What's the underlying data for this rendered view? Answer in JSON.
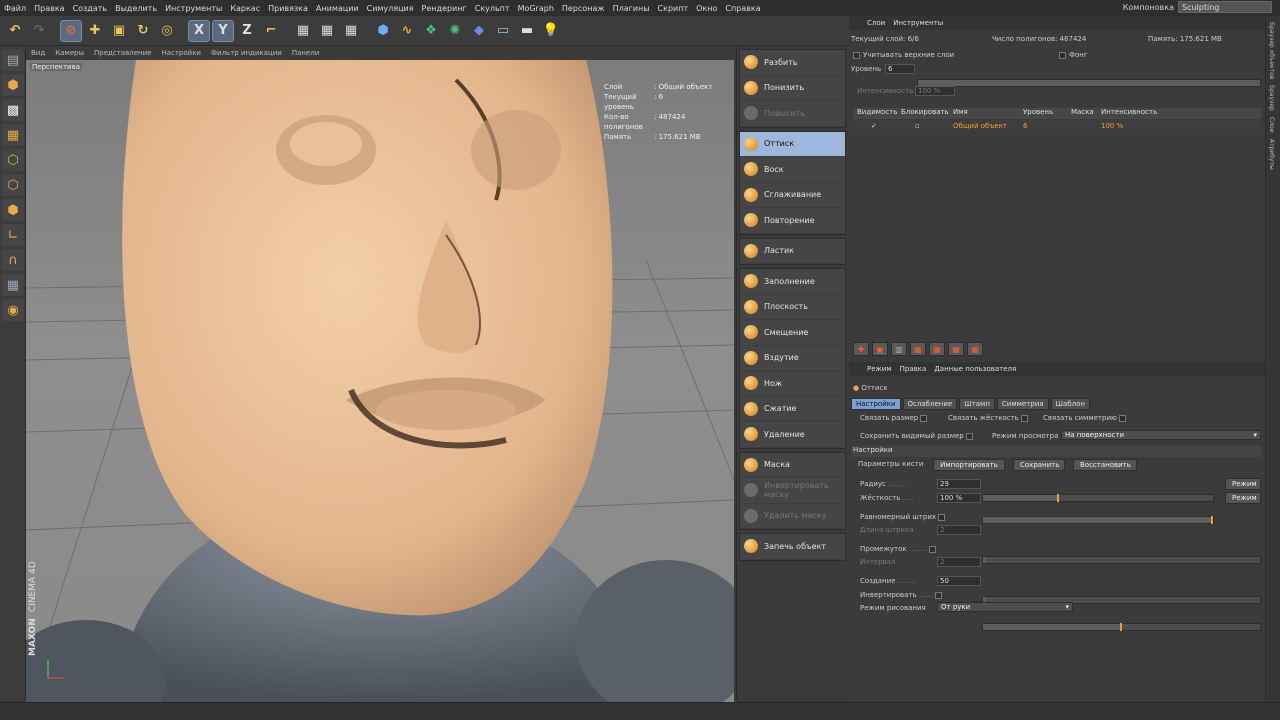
{
  "menu": [
    "Файл",
    "Правка",
    "Создать",
    "Выделить",
    "Инструменты",
    "Каркас",
    "Привязка",
    "Анимации",
    "Симуляция",
    "Рендеринг",
    "Скульпт",
    "MoGraph",
    "Персонаж",
    "Плагины",
    "Скрипт",
    "Окно",
    "Справка"
  ],
  "layout": {
    "label": "Компоновка",
    "value": "Sculpting"
  },
  "toolbar": {
    "x": "X",
    "y": "Y",
    "z": "Z"
  },
  "viewport_menu": [
    "Вид",
    "Камеры",
    "Представление",
    "Настройки",
    "Фильтр индикации",
    "Панели"
  ],
  "viewport": {
    "label": "Перспектива",
    "info": [
      [
        "Слой",
        ": Общий объект"
      ],
      [
        "Текущий уровень",
        ": 6"
      ],
      [
        "Кол-во полигонов",
        ": 487424"
      ],
      [
        "Память",
        ": 175.621 MB"
      ]
    ],
    "logo_line1": "MAXON",
    "logo_line2": "CINEMA 4D"
  },
  "brushes": {
    "g1": [
      {
        "label": "Разбить",
        "state": "normal"
      },
      {
        "label": "Понизить",
        "state": "normal"
      },
      {
        "label": "Повысить",
        "state": "disabled"
      }
    ],
    "g2": [
      {
        "label": "Оттиск",
        "state": "active"
      },
      {
        "label": "Воск",
        "state": "normal"
      },
      {
        "label": "Сглаживание",
        "state": "normal"
      },
      {
        "label": "Повторение",
        "state": "normal"
      }
    ],
    "g3": [
      {
        "label": "Ластик",
        "state": "normal"
      }
    ],
    "g4": [
      {
        "label": "Заполнение",
        "state": "normal"
      },
      {
        "label": "Плоскость",
        "state": "normal"
      },
      {
        "label": "Смещение",
        "state": "normal"
      },
      {
        "label": "Вздутие",
        "state": "normal"
      },
      {
        "label": "Нож",
        "state": "normal"
      },
      {
        "label": "Сжатие",
        "state": "normal"
      },
      {
        "label": "Удаление",
        "state": "normal"
      }
    ],
    "g5": [
      {
        "label": "Маска",
        "state": "normal"
      },
      {
        "label": "Инвертировать маску",
        "state": "disabled"
      },
      {
        "label": "Удалить маску",
        "state": "disabled"
      }
    ],
    "g6": [
      {
        "label": "Запечь объект",
        "state": "normal"
      }
    ]
  },
  "layers": {
    "tabs": [
      "Слои",
      "Инструменты"
    ],
    "current_level": "Текущий слой: 6/6",
    "poly_count": "Число полигонов: 487424",
    "memory": "Память: 175.621 MB",
    "consider_upper": "Учитывать верхние слои",
    "phong": "Фонг",
    "level_label": "Уровень",
    "level_value": "6",
    "intensity_label": "Интенсивность",
    "intensity_value": "100 %",
    "columns": [
      "Видимость",
      "Блокировать",
      "Имя",
      "Уровень",
      "Маска",
      "Интенсивность"
    ],
    "row": {
      "name": "Общий объект",
      "level": "6",
      "intensity": "100 %"
    }
  },
  "attrs": {
    "mode_menu": [
      "Режим",
      "Правка",
      "Данные пользователя"
    ],
    "title": "Оттиск",
    "tabs": [
      "Настройки",
      "Ослабление",
      "Штамп",
      "Симметрия",
      "Шаблон"
    ],
    "link_size": "Связать размер",
    "link_hardness": "Связать жёсткость",
    "link_symmetry": "Связать симметрию",
    "keep_visible": "Сохранить видимый размер",
    "view_mode": "Режим просмотра",
    "view_mode_value": "На поверхности",
    "section": "Настройки",
    "brush_params": "Параметры кисти",
    "import": "Импортировать",
    "save": "Сохранить",
    "restore": "Восстановить",
    "radius_label": "Радиус",
    "radius_value": "29",
    "radius_level": 0.33,
    "hardness_label": "Жёсткость",
    "hardness_value": "100 %",
    "hardness_level": 1.0,
    "mode_btn": "Режим",
    "even_stroke": "Равномерный штрих",
    "stroke_len": "Длина штриха",
    "stroke_len_value": "2",
    "gap": "Промежуток",
    "interval": "Интервал",
    "interval_value": "2",
    "create": "Создание",
    "create_value": "50",
    "create_level": 0.5,
    "invert": "Инвертировать",
    "draw_mode": "Режим рисования",
    "draw_mode_value": "От руки"
  },
  "right_strip": [
    "Браузер объектов",
    "Браузер",
    "Слои",
    "Атрибуты"
  ]
}
